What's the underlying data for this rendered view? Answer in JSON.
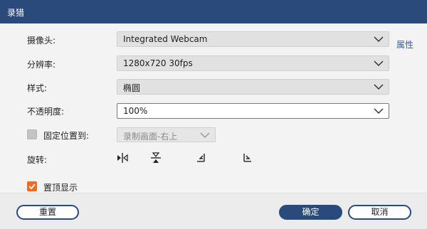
{
  "window": {
    "title": "录猎"
  },
  "form": {
    "camera": {
      "label": "摄像头:",
      "value": "Integrated Webcam",
      "link": "属性"
    },
    "resolution": {
      "label": "分辨率:",
      "value": "1280x720 30fps"
    },
    "style": {
      "label": "样式:",
      "value": "椭圆"
    },
    "opacity": {
      "label": "不透明度:",
      "value": "100%"
    },
    "fix_position": {
      "label": "固定位置到:",
      "checked": false,
      "value": "录制画面-右上"
    },
    "rotate": {
      "label": "旋转:",
      "icons": [
        "flip-horizontal-icon",
        "flip-vertical-icon",
        "rotate-left-icon",
        "rotate-right-icon"
      ]
    },
    "topmost": {
      "label": "置顶显示",
      "checked": true
    }
  },
  "footer": {
    "reset_label": "重置",
    "ok_label": "确定",
    "cancel_label": "取消"
  },
  "colors": {
    "titlebar": "#2a4a7b",
    "accent_checkbox": "#f06a22",
    "link": "#2a5ea8"
  }
}
